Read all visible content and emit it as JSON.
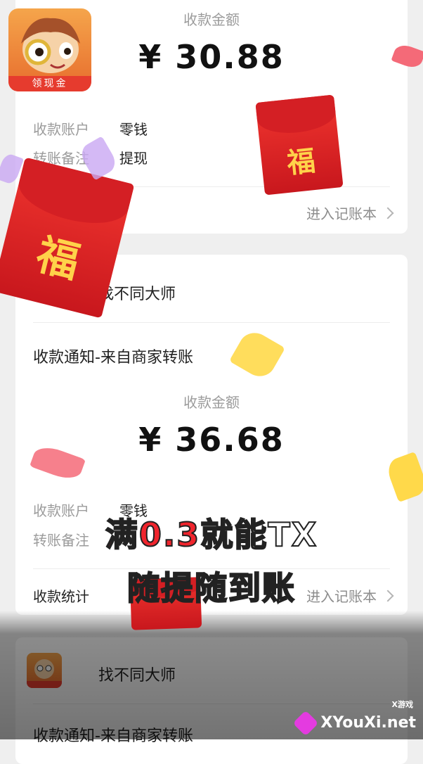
{
  "app_icon": {
    "label": "领现金"
  },
  "card1": {
    "amount_label": "收款金额",
    "amount": "¥ 30.88",
    "account_label": "收款账户",
    "account_value": "零钱",
    "note_label": "转账备注",
    "note_value": "提现",
    "ledger_link": "进入记账本"
  },
  "card2": {
    "merchant": "找不同大师",
    "notice": "收款通知-来自商家转账",
    "amount_label": "收款金额",
    "amount": "¥ 36.68",
    "account_label": "收款账户",
    "account_value": "零钱",
    "note_label": "转账备注",
    "stats_label": "收款统计",
    "ledger_link": "进入记账本"
  },
  "card3": {
    "merchant": "找不同大师",
    "notice": "收款通知-来自商家转账"
  },
  "caption": {
    "line1_hl": "满0.3",
    "line1_rest": "就能TX",
    "line2": "随提随到账"
  },
  "envelopes": {
    "char1": "福",
    "char2": "福"
  },
  "watermark": {
    "tag": "X游戏",
    "text": "XYouXi.net"
  }
}
